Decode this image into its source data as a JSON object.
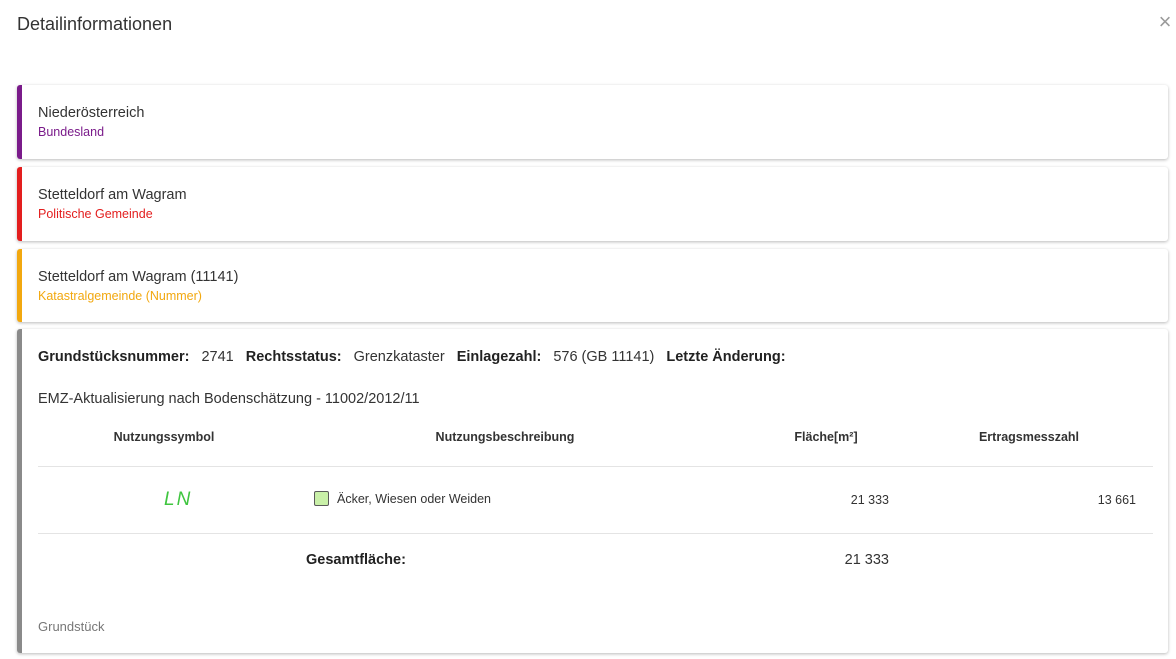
{
  "dialog": {
    "title": "Detailinformationen",
    "close_icon": "close-icon"
  },
  "cards": [
    {
      "main": "Niederösterreich",
      "sub": "Bundesland",
      "color": "#7a1b8a"
    },
    {
      "main": "Stetteldorf am Wagram",
      "sub": "Politische Gemeinde",
      "color": "#e31e1e"
    },
    {
      "main": "Stetteldorf am Wagram (11141)",
      "sub": "Katastralgemeinde (Nummer)",
      "color": "#f2a80f"
    }
  ],
  "parcel": {
    "color": "#8a8a8a",
    "fields": {
      "grundstuecksnummer_label": "Grundstücksnummer:",
      "grundstuecksnummer_value": "2741",
      "rechtsstatus_label": "Rechtsstatus:",
      "rechtsstatus_value": "Grenzkataster",
      "einlagezahl_label": "Einlagezahl:",
      "einlagezahl_value": "576 (GB 11141)",
      "letzte_aenderung_label": "Letzte Änderung:"
    },
    "change_description": "EMZ-Aktualisierung nach Bodenschätzung - 11002/2012/11",
    "table": {
      "headers": [
        "Nutzungssymbol",
        "Nutzungsbeschreibung",
        "Fläche[m²]",
        "Ertragsmesszahl"
      ],
      "rows": [
        {
          "symbol": "LN",
          "symbol_color": "#3fc53f",
          "swatch_color": "#c9f0a8",
          "description": "Äcker, Wiesen oder Weiden",
          "area": "21 333",
          "yield": "13 661"
        }
      ]
    },
    "total_label": "Gesamtfläche:",
    "total_value": "21 333",
    "footer_label": "Grundstück"
  }
}
